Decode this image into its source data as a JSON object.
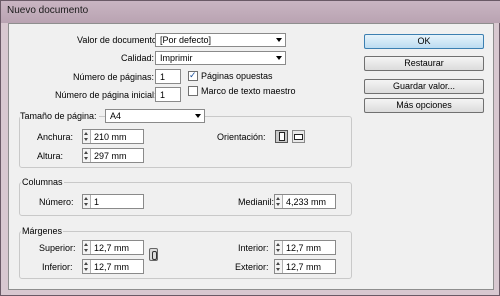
{
  "window": {
    "title": "Nuevo documento"
  },
  "preset": {
    "label": "Valor de documento:",
    "value": "[Por defecto]"
  },
  "quality": {
    "label": "Calidad:",
    "value": "Imprimir"
  },
  "pages": {
    "count_label": "Número de páginas:",
    "count_value": "1",
    "start_label": "Número de página inicial:",
    "start_value": "1",
    "facing_label": "Páginas opuestas",
    "facing_checked": true,
    "master_label": "Marco de texto maestro",
    "master_checked": false
  },
  "page_size": {
    "label": "Tamaño de página:",
    "value": "A4",
    "width_label": "Anchura:",
    "width_value": "210 mm",
    "height_label": "Altura:",
    "height_value": "297 mm",
    "orientation_label": "Orientación:",
    "orientation_options": [
      "portrait",
      "landscape"
    ],
    "orientation_selected": "portrait"
  },
  "columns": {
    "title": "Columnas",
    "number_label": "Número:",
    "number_value": "1",
    "gutter_label": "Medianil:",
    "gutter_value": "4,233 mm"
  },
  "margins": {
    "title": "Márgenes",
    "top_label": "Superior:",
    "top_value": "12,7 mm",
    "bottom_label": "Inferior:",
    "bottom_value": "12,7 mm",
    "inside_label": "Interior:",
    "inside_value": "12,7 mm",
    "outside_label": "Exterior:",
    "outside_value": "12,7 mm"
  },
  "buttons": {
    "ok": "OK",
    "reset": "Restaurar",
    "save_preset": "Guardar valor...",
    "more_options": "Más opciones"
  }
}
